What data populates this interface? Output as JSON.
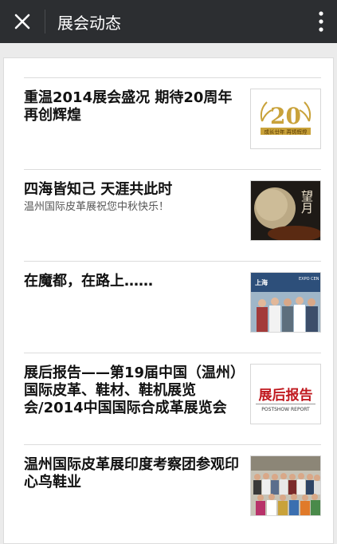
{
  "header": {
    "title": "展会动态",
    "close_icon": "close-icon",
    "more_icon": "more-vertical-icon"
  },
  "articles": [
    {
      "title": "重温2014展会盛况 期待20周年再创辉煌",
      "subtitle": "",
      "thumb_text": "20",
      "thumb_caption": "成长廿年 再铸辉煌"
    },
    {
      "title": "四海皆知己 天涯共此时",
      "subtitle": "温州国际皮革展祝您中秋快乐！",
      "thumb_text": "望月",
      "thumb_caption": ""
    },
    {
      "title": "在魔都，在路上……",
      "subtitle": "",
      "thumb_text": "上海",
      "thumb_caption": "EXPO CEN"
    },
    {
      "title": "展后报告——第19届中国（温州）国际皮革、鞋材、鞋机展览会/2014中国国际合成革展览会",
      "subtitle": "",
      "thumb_text": "展后报告",
      "thumb_caption": "POSTSHOW REPORT"
    },
    {
      "title": "温州国际皮革展印度考察团参观印心鸟鞋业",
      "subtitle": "",
      "thumb_text": "",
      "thumb_caption": ""
    }
  ],
  "colors": {
    "topbar": "#2c2e31",
    "background": "#ebebeb",
    "report_red": "#c0181e",
    "gold": "#c9a23a"
  }
}
